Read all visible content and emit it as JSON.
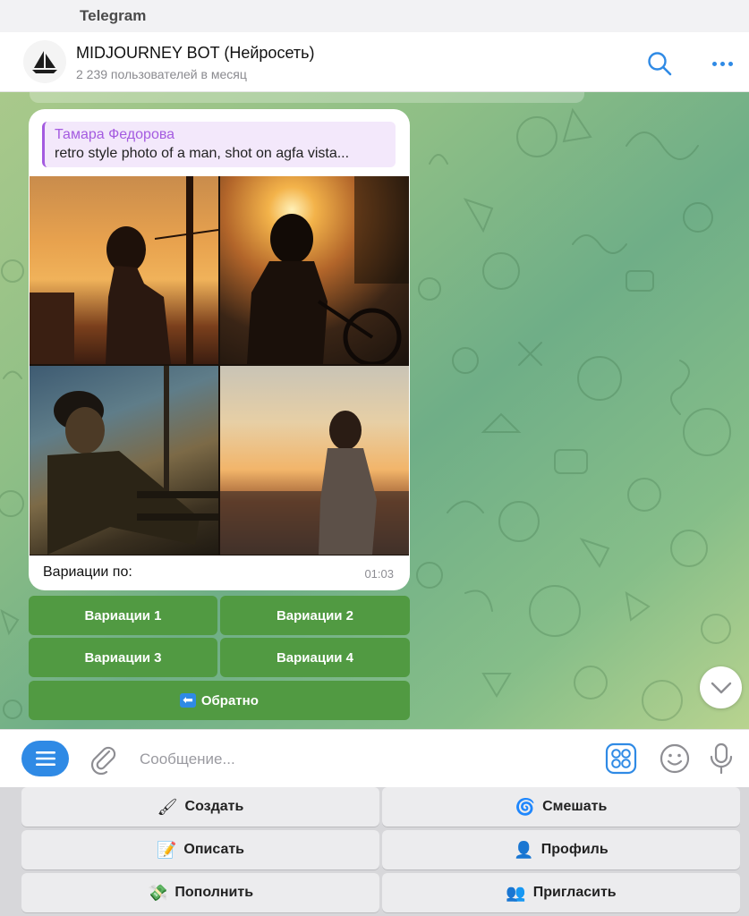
{
  "os": {
    "app_name": "Telegram"
  },
  "header": {
    "title": "MIDJOURNEY BOT (Нейросеть)",
    "subtitle": "2 239 пользователей в месяц"
  },
  "message": {
    "reply_author": "Тамара Федорова",
    "reply_text": "retro style photo of a man, shot on agfa vista...",
    "caption": "Вариации по:",
    "time": "01:03"
  },
  "inline_buttons": {
    "var1": "Вариации 1",
    "var2": "Вариации 2",
    "var3": "Вариации 3",
    "var4": "Вариации 4",
    "back_emoji": "⬅",
    "back": "Обратно"
  },
  "composer": {
    "placeholder": "Сообщение..."
  },
  "keyboard": {
    "create": {
      "emoji": "🖌",
      "label": "Создать"
    },
    "mix": {
      "emoji": "🌀",
      "label": "Смешать"
    },
    "describe": {
      "emoji": "📝",
      "label": "Описать"
    },
    "profile": {
      "emoji": "👤",
      "label": "Профиль"
    },
    "topup": {
      "emoji": "💸",
      "label": "Пополнить"
    },
    "invite": {
      "emoji": "👥",
      "label": "Пригласить"
    }
  },
  "colors": {
    "accent": "#2f8ae5",
    "inline_button": "#519a42",
    "reply_accent": "#a45be0"
  }
}
